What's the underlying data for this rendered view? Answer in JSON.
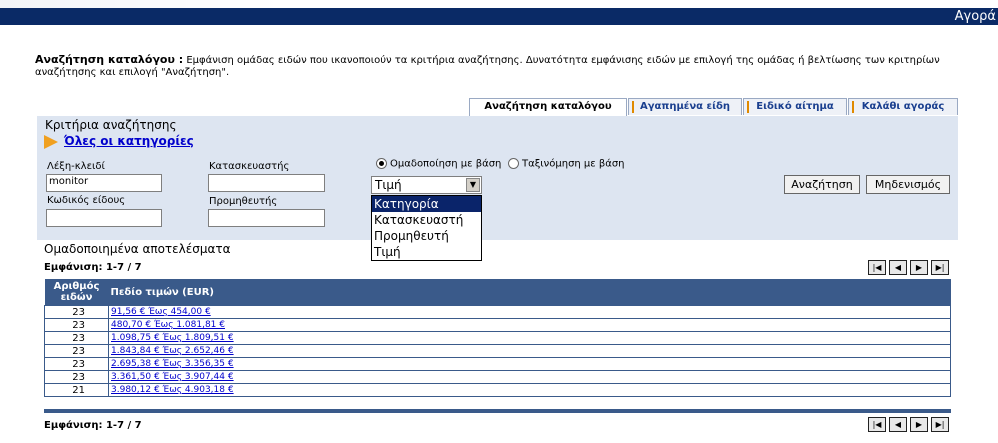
{
  "header": {
    "title": "Αγορά"
  },
  "description": {
    "bold": "Αναζήτηση καταλόγου :",
    "text": " Εμφάνιση ομάδας ειδών που ικανοποιούν τα κριτήρια αναζήτησης. Δυνατότητα εμφάνισης ειδών με επιλογή της ομάδας ή βελτίωσης των κριτηρίων αναζήτησης και επιλογή \"Αναζήτηση\"."
  },
  "tabs": [
    "Αναζήτηση καταλόγου",
    "Αγαπημένα είδη",
    "Ειδικό αίτημα",
    "Καλάθι αγοράς"
  ],
  "criteria": {
    "heading": "Κριτήρια αναζήτησης",
    "all_categories": "Όλες οι κατηγορίες",
    "keyword_label": "Λέξη-κλειδί",
    "keyword_value": "monitor",
    "manufacturer_label": "Κατασκευαστής",
    "manufacturer_value": "",
    "item_code_label": "Κωδικός είδους",
    "item_code_value": "",
    "supplier_label": "Προμηθευτής",
    "supplier_value": "",
    "group_by_label": "Ομαδοποίηση με βάση",
    "sort_by_label": "Ταξινόμηση με βάση",
    "group_select_value": "Τιμή",
    "dropdown_options": [
      "Κατηγορία",
      "Κατασκευαστή",
      "Προμηθευτή",
      "Τιμή"
    ],
    "search_button": "Αναζήτηση",
    "reset_button": "Μηδενισμός"
  },
  "results": {
    "heading": "Ομαδοποιημένα αποτελέσματα",
    "showing_top": "Εμφάνιση: 1-7 / 7",
    "showing_bottom": "Εμφάνιση: 1-7 / 7",
    "col_count_line1": "Αριθμός",
    "col_count_line2": "ειδών",
    "col_price": "Πεδίο τιμών (EUR)",
    "rows": [
      {
        "count": "23",
        "range": "91,56 € Έως 454,00 €"
      },
      {
        "count": "23",
        "range": "480,70 € Έως 1.081,81 €"
      },
      {
        "count": "23",
        "range": "1.098,75 € Έως 1.809,51 €"
      },
      {
        "count": "23",
        "range": "1.843,84 € Έως 2.652,46 €"
      },
      {
        "count": "23",
        "range": "2.695,38 € Έως 3.356,35 €"
      },
      {
        "count": "23",
        "range": "3.361,50 € Έως 3.907,44 €"
      },
      {
        "count": "21",
        "range": "3.980,12 € Έως 4.903,18 €"
      }
    ]
  },
  "nav_icons": [
    "first-page-icon",
    "prev-page-icon",
    "next-page-icon",
    "last-page-icon"
  ]
}
